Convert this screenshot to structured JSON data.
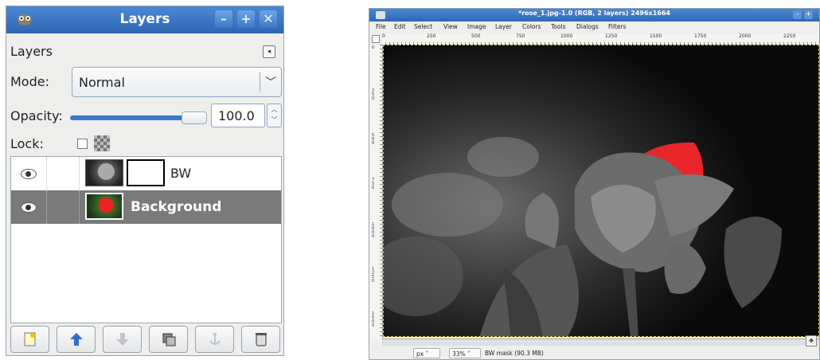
{
  "layers_dock": {
    "title": "Layers",
    "tab_label": "Layers",
    "mode_label": "Mode:",
    "mode_value": "Normal",
    "opacity_label": "Opacity:",
    "opacity_value": "100.0",
    "opacity_fraction": 1.0,
    "lock_label": "Lock:",
    "layers": [
      {
        "name": "BW",
        "visible": true,
        "has_mask": true,
        "selected": false
      },
      {
        "name": "Background",
        "visible": true,
        "has_mask": false,
        "selected": true
      }
    ],
    "buttons": [
      "new-layer",
      "raise-layer",
      "lower-layer",
      "duplicate-layer",
      "anchor-layer",
      "delete-layer"
    ]
  },
  "image_window": {
    "title": "*rose_1.jpg-1.0 (RGB, 2 layers) 2496x1664",
    "menu": [
      "File",
      "Edit",
      "Select",
      "View",
      "Image",
      "Layer",
      "Colors",
      "Tools",
      "Dialogs",
      "Filters"
    ],
    "ruler_h_ticks": [
      "0",
      "250",
      "500",
      "750",
      "1000",
      "1250",
      "1500",
      "1750",
      "2000",
      "2250"
    ],
    "ruler_v_ticks": [
      "0",
      "250",
      "500",
      "750",
      "1000",
      "1250",
      "1500"
    ],
    "unit": "px",
    "zoom": "33%",
    "status": "BW mask (90.3 MB)"
  },
  "colors": {
    "titlebar": "#2f66b4",
    "selection": "#7a7a7a",
    "rose_red": "#e8262a"
  }
}
